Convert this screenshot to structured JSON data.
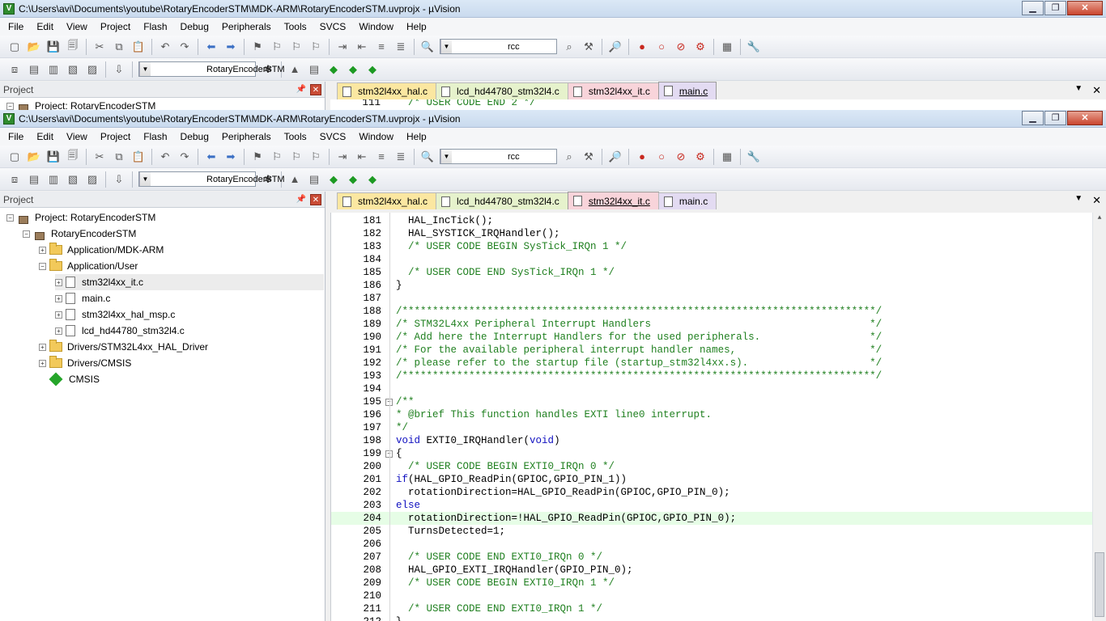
{
  "window_back": {
    "title": "C:\\Users\\avi\\Documents\\youtube\\RotaryEncoderSTM\\MDK-ARM\\RotaryEncoderSTM.uvprojx - µVision",
    "menus": [
      "File",
      "Edit",
      "View",
      "Project",
      "Flash",
      "Debug",
      "Peripherals",
      "Tools",
      "SVCS",
      "Window",
      "Help"
    ],
    "find_value": "rcc",
    "target_value": "RotaryEncoderSTM",
    "panel_title": "Project",
    "tree_partial": "Project: RotaryEncoderSTM",
    "tabs": [
      "stm32l4xx_hal.c",
      "lcd_hd44780_stm32l4.c",
      "stm32l4xx_it.c",
      "main.c"
    ],
    "active_tab": 3,
    "code_partial_num": "111",
    "code_partial_text": "/* USER CODE END 2 */"
  },
  "window_front": {
    "title": "C:\\Users\\avi\\Documents\\youtube\\RotaryEncoderSTM\\MDK-ARM\\RotaryEncoderSTM.uvprojx - µVision",
    "menus": [
      "File",
      "Edit",
      "View",
      "Project",
      "Flash",
      "Debug",
      "Peripherals",
      "Tools",
      "SVCS",
      "Window",
      "Help"
    ],
    "find_value": "rcc",
    "target_value": "RotaryEncoderSTM",
    "panel_title": "Project",
    "tabs": [
      "stm32l4xx_hal.c",
      "lcd_hd44780_stm32l4.c",
      "stm32l4xx_it.c",
      "main.c"
    ],
    "active_tab": 2,
    "tree": [
      {
        "label": "Project: RotaryEncoderSTM",
        "depth": 0,
        "icon": "project-icon",
        "exp": "-"
      },
      {
        "label": "RotaryEncoderSTM",
        "depth": 1,
        "icon": "target-icon",
        "exp": "-"
      },
      {
        "label": "Application/MDK-ARM",
        "depth": 2,
        "icon": "folder-icon",
        "exp": "+"
      },
      {
        "label": "Application/User",
        "depth": 2,
        "icon": "folder-icon",
        "exp": "-"
      },
      {
        "label": "stm32l4xx_it.c",
        "depth": 3,
        "icon": "file-icon",
        "exp": "+",
        "selected": true
      },
      {
        "label": "main.c",
        "depth": 3,
        "icon": "file-icon",
        "exp": "+"
      },
      {
        "label": "stm32l4xx_hal_msp.c",
        "depth": 3,
        "icon": "file-icon",
        "exp": "+"
      },
      {
        "label": "lcd_hd44780_stm32l4.c",
        "depth": 3,
        "icon": "file-icon",
        "exp": "+"
      },
      {
        "label": "Drivers/STM32L4xx_HAL_Driver",
        "depth": 2,
        "icon": "folder-icon",
        "exp": "+"
      },
      {
        "label": "Drivers/CMSIS",
        "depth": 2,
        "icon": "folder-icon",
        "exp": "+"
      },
      {
        "label": "CMSIS",
        "depth": 2,
        "icon": "gem-icon",
        "exp": ""
      }
    ],
    "code": [
      {
        "n": "181",
        "t": "  HAL_IncTick();",
        "k": "plain"
      },
      {
        "n": "182",
        "t": "  HAL_SYSTICK_IRQHandler();",
        "k": "plain"
      },
      {
        "n": "183",
        "t": "  /* USER CODE BEGIN SysTick_IRQn 1 */",
        "k": "comment"
      },
      {
        "n": "184",
        "t": "",
        "k": "plain"
      },
      {
        "n": "185",
        "t": "  /* USER CODE END SysTick_IRQn 1 */",
        "k": "comment"
      },
      {
        "n": "186",
        "t": "}",
        "k": "plain"
      },
      {
        "n": "187",
        "t": "",
        "k": "plain"
      },
      {
        "n": "188",
        "t": "/******************************************************************************/",
        "k": "comment"
      },
      {
        "n": "189",
        "t": "/* STM32L4xx Peripheral Interrupt Handlers                                    */",
        "k": "comment"
      },
      {
        "n": "190",
        "t": "/* Add here the Interrupt Handlers for the used peripherals.                  */",
        "k": "comment"
      },
      {
        "n": "191",
        "t": "/* For the available peripheral interrupt handler names,                      */",
        "k": "comment"
      },
      {
        "n": "192",
        "t": "/* please refer to the startup file (startup_stm32l4xx.s).                    */",
        "k": "comment"
      },
      {
        "n": "193",
        "t": "/******************************************************************************/",
        "k": "comment"
      },
      {
        "n": "194",
        "t": "",
        "k": "plain"
      },
      {
        "n": "195",
        "t": "/**",
        "k": "comment"
      },
      {
        "n": "196",
        "t": "* @brief This function handles EXTI line0 interrupt.",
        "k": "comment"
      },
      {
        "n": "197",
        "t": "*/",
        "k": "comment"
      },
      {
        "n": "198",
        "t": "void EXTI0_IRQHandler(void)",
        "k": "decl"
      },
      {
        "n": "199",
        "t": "{",
        "k": "plain"
      },
      {
        "n": "200",
        "t": "  /* USER CODE BEGIN EXTI0_IRQn 0 */",
        "k": "comment"
      },
      {
        "n": "201",
        "t": "if(HAL_GPIO_ReadPin(GPIOC,GPIO_PIN_1))",
        "k": "if"
      },
      {
        "n": "202",
        "t": "  rotationDirection=HAL_GPIO_ReadPin(GPIOC,GPIO_PIN_0);",
        "k": "plain"
      },
      {
        "n": "203",
        "t": "else",
        "k": "kw"
      },
      {
        "n": "204",
        "t": "  rotationDirection=!HAL_GPIO_ReadPin(GPIOC,GPIO_PIN_0);",
        "k": "plain",
        "hl": true
      },
      {
        "n": "205",
        "t": "  TurnsDetected=1;",
        "k": "plain"
      },
      {
        "n": "206",
        "t": "",
        "k": "plain"
      },
      {
        "n": "207",
        "t": "  /* USER CODE END EXTI0_IRQn 0 */",
        "k": "comment"
      },
      {
        "n": "208",
        "t": "  HAL_GPIO_EXTI_IRQHandler(GPIO_PIN_0);",
        "k": "plain"
      },
      {
        "n": "209",
        "t": "  /* USER CODE BEGIN EXTI0_IRQn 1 */",
        "k": "comment"
      },
      {
        "n": "210",
        "t": "",
        "k": "plain"
      },
      {
        "n": "211",
        "t": "  /* USER CODE END EXTI0_IRQn 1 */",
        "k": "comment"
      },
      {
        "n": "212",
        "t": "}",
        "k": "plain"
      }
    ]
  },
  "colors": {
    "comment": "#208020",
    "keyword": "#1010c0",
    "highlight": "#e6fde6"
  }
}
